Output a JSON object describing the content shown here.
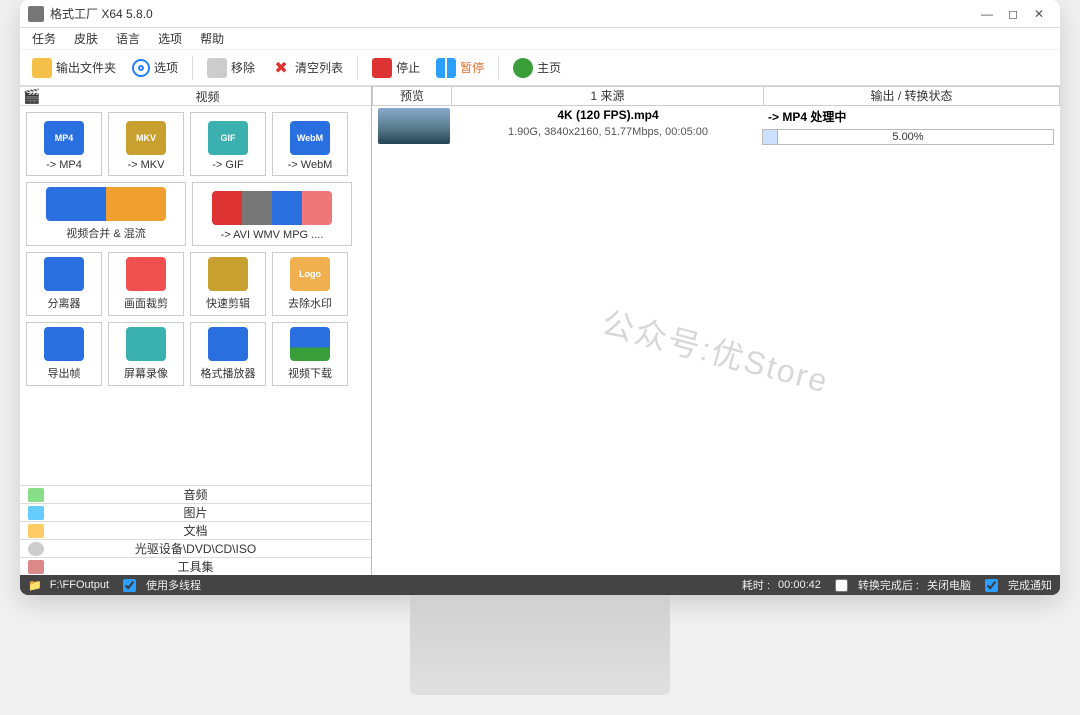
{
  "window": {
    "title": "格式工厂 X64 5.8.0"
  },
  "menu": {
    "items": [
      "任务",
      "皮肤",
      "语言",
      "选项",
      "帮助"
    ]
  },
  "toolbar": {
    "output_folder": "输出文件夹",
    "options": "选项",
    "remove": "移除",
    "clear_list": "清空列表",
    "stop": "停止",
    "pause": "暂停",
    "home": "主页"
  },
  "left": {
    "video_header": "视频",
    "tools": [
      {
        "label": "-> MP4",
        "cls": "bg-mp4",
        "ic": "MP4"
      },
      {
        "label": "-> MKV",
        "cls": "bg-mkv",
        "ic": "MKV"
      },
      {
        "label": "-> GIF",
        "cls": "bg-gif",
        "ic": "GIF"
      },
      {
        "label": "-> WebM",
        "cls": "bg-webm",
        "ic": "WebM"
      },
      {
        "label": "视频合并 & 混流",
        "cls": "bg-merge",
        "wide": true,
        "ic": ""
      },
      {
        "label": "-> AVI WMV MPG ....",
        "cls": "bg-avi",
        "wide": true,
        "ic": ""
      },
      {
        "label": "分离器",
        "cls": "bg-split",
        "ic": ""
      },
      {
        "label": "画面裁剪",
        "cls": "bg-crop",
        "ic": ""
      },
      {
        "label": "快速剪辑",
        "cls": "bg-cut",
        "ic": ""
      },
      {
        "label": "去除水印",
        "cls": "bg-logo",
        "ic": "Logo"
      },
      {
        "label": "导出帧",
        "cls": "bg-export",
        "ic": ""
      },
      {
        "label": "屏幕录像",
        "cls": "bg-rec",
        "ic": ""
      },
      {
        "label": "格式播放器",
        "cls": "bg-play",
        "ic": ""
      },
      {
        "label": "视频下载",
        "cls": "bg-dl",
        "ic": ""
      }
    ],
    "categories": [
      "音频",
      "图片",
      "文档",
      "光驱设备\\DVD\\CD\\ISO",
      "工具集"
    ]
  },
  "right": {
    "headers": {
      "preview": "预览",
      "source": "1 来源",
      "status": "输出 / 转换状态"
    },
    "file": {
      "name": "4K  (120 FPS).mp4",
      "info": "1.90G, 3840x2160, 51.77Mbps, 00:05:00",
      "status_label": "-> MP4 处理中",
      "progress_pct": 5.0,
      "progress_text": "5.00%"
    },
    "watermark": "公众号:优Store"
  },
  "status": {
    "output_path": "F:\\FFOutput",
    "multithread_label": "使用多线程",
    "elapsed_label": "耗时 :",
    "elapsed": "00:00:42",
    "after_label": "转换完成后 :",
    "after_action": "关闭电脑",
    "done_notify": "完成通知"
  }
}
